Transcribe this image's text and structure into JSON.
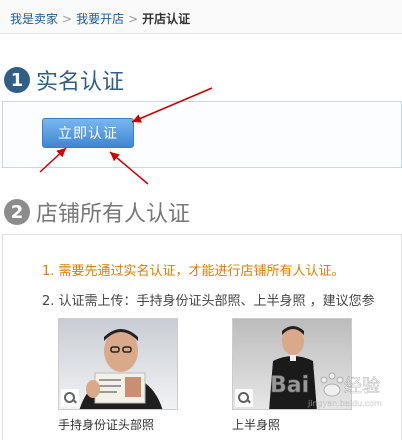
{
  "breadcrumb": {
    "items": [
      "我是卖家",
      "我要开店"
    ],
    "current": "开店认证"
  },
  "section1": {
    "number": "1",
    "title": "实名认证",
    "button_label": "立即认证"
  },
  "section2": {
    "number": "2",
    "title": "店铺所有人认证",
    "requirement1": "1. 需要先通过实名认证，才能进行店铺所有人认证。",
    "requirement2": "2. 认证需上传：手持身份证头部照、上半身照 ，建议您参",
    "photos": [
      {
        "caption": "手持身份证头部照",
        "icon": "zoom-icon"
      },
      {
        "caption": "上半身照",
        "icon": "zoom-icon"
      }
    ]
  },
  "colors": {
    "link": "#1d5a99",
    "section_active": "#2f5f86",
    "section_inactive": "#8c8c8c",
    "button": "#3f86d2",
    "warning_text": "#e07b00",
    "arrow": "#cc0000"
  }
}
